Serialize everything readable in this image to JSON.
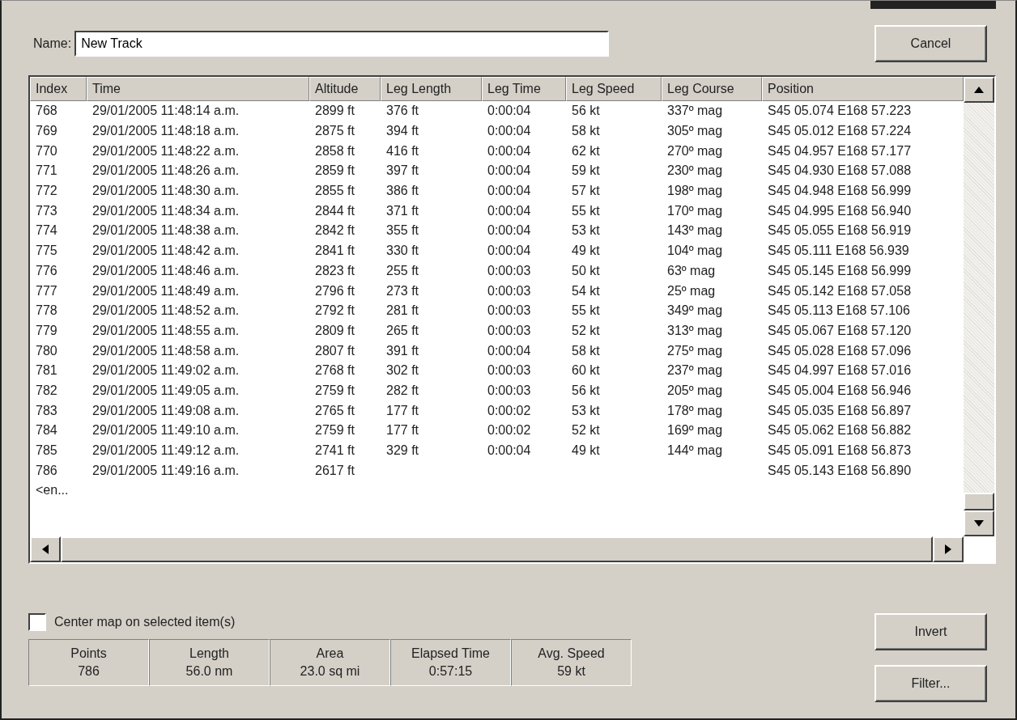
{
  "name_field": {
    "label": "Name:",
    "value": "New Track"
  },
  "buttons": {
    "cancel": "Cancel",
    "invert": "Invert",
    "filter": "Filter..."
  },
  "table": {
    "columns": [
      "Index",
      "Time",
      "Altitude",
      "Leg Length",
      "Leg Time",
      "Leg Speed",
      "Leg Course",
      "Position"
    ],
    "rows": [
      [
        "768",
        "29/01/2005 11:48:14 a.m.",
        "2899 ft",
        "376 ft",
        "0:00:04",
        "56 kt",
        "337º mag",
        "S45 05.074 E168 57.223"
      ],
      [
        "769",
        "29/01/2005 11:48:18 a.m.",
        "2875 ft",
        "394 ft",
        "0:00:04",
        "58 kt",
        "305º mag",
        "S45 05.012 E168 57.224"
      ],
      [
        "770",
        "29/01/2005 11:48:22 a.m.",
        "2858 ft",
        "416 ft",
        "0:00:04",
        "62 kt",
        "270º mag",
        "S45 04.957 E168 57.177"
      ],
      [
        "771",
        "29/01/2005 11:48:26 a.m.",
        "2859 ft",
        "397 ft",
        "0:00:04",
        "59 kt",
        "230º mag",
        "S45 04.930 E168 57.088"
      ],
      [
        "772",
        "29/01/2005 11:48:30 a.m.",
        "2855 ft",
        "386 ft",
        "0:00:04",
        "57 kt",
        "198º mag",
        "S45 04.948 E168 56.999"
      ],
      [
        "773",
        "29/01/2005 11:48:34 a.m.",
        "2844 ft",
        "371 ft",
        "0:00:04",
        "55 kt",
        "170º mag",
        "S45 04.995 E168 56.940"
      ],
      [
        "774",
        "29/01/2005 11:48:38 a.m.",
        "2842 ft",
        "355 ft",
        "0:00:04",
        "53 kt",
        "143º mag",
        "S45 05.055 E168 56.919"
      ],
      [
        "775",
        "29/01/2005 11:48:42 a.m.",
        "2841 ft",
        "330 ft",
        "0:00:04",
        "49 kt",
        "104º mag",
        "S45 05.111 E168 56.939"
      ],
      [
        "776",
        "29/01/2005 11:48:46 a.m.",
        "2823 ft",
        "255 ft",
        "0:00:03",
        "50 kt",
        "63º mag",
        "S45 05.145 E168 56.999"
      ],
      [
        "777",
        "29/01/2005 11:48:49 a.m.",
        "2796 ft",
        "273 ft",
        "0:00:03",
        "54 kt",
        "25º mag",
        "S45 05.142 E168 57.058"
      ],
      [
        "778",
        "29/01/2005 11:48:52 a.m.",
        "2792 ft",
        "281 ft",
        "0:00:03",
        "55 kt",
        "349º mag",
        "S45 05.113 E168 57.106"
      ],
      [
        "779",
        "29/01/2005 11:48:55 a.m.",
        "2809 ft",
        "265 ft",
        "0:00:03",
        "52 kt",
        "313º mag",
        "S45 05.067 E168 57.120"
      ],
      [
        "780",
        "29/01/2005 11:48:58 a.m.",
        "2807 ft",
        "391 ft",
        "0:00:04",
        "58 kt",
        "275º mag",
        "S45 05.028 E168 57.096"
      ],
      [
        "781",
        "29/01/2005 11:49:02 a.m.",
        "2768 ft",
        "302 ft",
        "0:00:03",
        "60 kt",
        "237º mag",
        "S45 04.997 E168 57.016"
      ],
      [
        "782",
        "29/01/2005 11:49:05 a.m.",
        "2759 ft",
        "282 ft",
        "0:00:03",
        "56 kt",
        "205º mag",
        "S45 05.004 E168 56.946"
      ],
      [
        "783",
        "29/01/2005 11:49:08 a.m.",
        "2765 ft",
        "177 ft",
        "0:00:02",
        "53 kt",
        "178º mag",
        "S45 05.035 E168 56.897"
      ],
      [
        "784",
        "29/01/2005 11:49:10 a.m.",
        "2759 ft",
        "177 ft",
        "0:00:02",
        "52 kt",
        "169º mag",
        "S45 05.062 E168 56.882"
      ],
      [
        "785",
        "29/01/2005 11:49:12 a.m.",
        "2741 ft",
        "329 ft",
        "0:00:04",
        "49 kt",
        "144º mag",
        "S45 05.091 E168 56.873"
      ],
      [
        "786",
        "29/01/2005 11:49:16 a.m.",
        "2617 ft",
        null,
        null,
        null,
        null,
        "S45 05.143 E168 56.890"
      ],
      [
        "<en...",
        null,
        null,
        null,
        null,
        null,
        null,
        null
      ]
    ]
  },
  "center_map": {
    "label": "Center map on selected item(s)",
    "checked": false
  },
  "stats": [
    {
      "label": "Points",
      "value": "786"
    },
    {
      "label": "Length",
      "value": "56.0 nm"
    },
    {
      "label": "Area",
      "value": "23.0 sq mi"
    },
    {
      "label": "Elapsed Time",
      "value": "0:57:15"
    },
    {
      "label": "Avg. Speed",
      "value": "59 kt"
    }
  ]
}
